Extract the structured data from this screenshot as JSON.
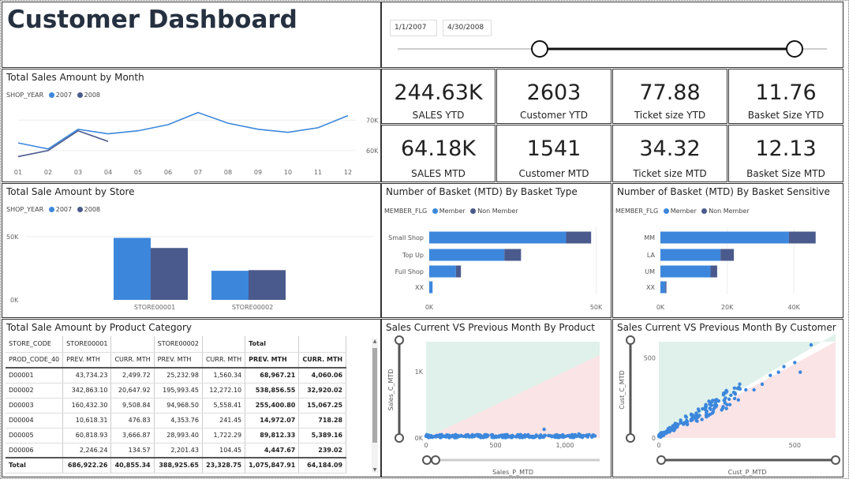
{
  "title": "Customer Dashboard",
  "date_range": {
    "start": "1/1/2007",
    "end": "4/30/2008"
  },
  "kpis": {
    "sales_ytd": {
      "value": "244.63K",
      "label": "SALES YTD"
    },
    "customer_ytd": {
      "value": "2603",
      "label": "Customer YTD"
    },
    "ticket_ytd": {
      "value": "77.88",
      "label": "Ticket size YTD"
    },
    "basket_ytd": {
      "value": "11.76",
      "label": "Basket Size YTD"
    },
    "sales_mtd": {
      "value": "64.18K",
      "label": "SALES MTD"
    },
    "customer_mtd": {
      "value": "1541",
      "label": "Customer MTD"
    },
    "ticket_mtd": {
      "value": "34.32",
      "label": "Ticket size MTD"
    },
    "basket_mtd": {
      "value": "12.13",
      "label": "Basket Size MTD"
    }
  },
  "colors": {
    "c2007": "#3c87dc",
    "c2008": "#4a5a8c",
    "green_zone": "#dff1ea",
    "red_zone": "#fbe4e6"
  },
  "chart_data": [
    {
      "type": "line",
      "title": "Total Sales Amount by Month",
      "legend_title": "SHOP_YEAR",
      "x": [
        "01",
        "02",
        "03",
        "04",
        "05",
        "06",
        "07",
        "08",
        "09",
        "10",
        "11",
        "12"
      ],
      "series": [
        {
          "name": "2007",
          "values": [
            62500,
            60500,
            67000,
            65500,
            66500,
            68500,
            72500,
            69000,
            67000,
            66000,
            67500,
            71500
          ]
        },
        {
          "name": "2008",
          "values": [
            58000,
            60000,
            66500,
            63000
          ]
        }
      ],
      "y_ticks": [
        "60K",
        "70K"
      ],
      "ylim": [
        55000,
        75000
      ]
    },
    {
      "type": "bar",
      "title": "Total Sale Amount by Store",
      "legend_title": "SHOP_YEAR",
      "categories": [
        "STORE00001",
        "STORE00002"
      ],
      "series": [
        {
          "name": "2007",
          "values": [
            49000,
            23000
          ]
        },
        {
          "name": "2008",
          "values": [
            41000,
            23500
          ]
        }
      ],
      "y_ticks": [
        "0K",
        "50K"
      ],
      "ylim": [
        0,
        58000
      ]
    },
    {
      "type": "bar",
      "title": "Number of Basket (MTD) By Basket Type",
      "legend_title": "MEMBER_FLG",
      "categories": [
        "Small Shop",
        "Top Up",
        "Full Shop",
        "XX"
      ],
      "series": [
        {
          "name": "Member",
          "values": [
            41000,
            22500,
            8000,
            1000
          ]
        },
        {
          "name": "Non Member",
          "values": [
            7500,
            5000,
            1500,
            0
          ]
        }
      ],
      "x_ticks": [
        "0K",
        "50K"
      ],
      "xlim": [
        0,
        52000
      ]
    },
    {
      "type": "bar",
      "title": "Number of Basket (MTD) By Basket Sensitive",
      "legend_title": "MEMBER_FLG",
      "categories": [
        "MM",
        "LA",
        "UM",
        "XX"
      ],
      "series": [
        {
          "name": "Member",
          "values": [
            38500,
            18000,
            15000,
            1500
          ]
        },
        {
          "name": "Non Member",
          "values": [
            8000,
            4000,
            2000,
            300
          ]
        }
      ],
      "x_ticks": [
        "0K",
        "20K",
        "40K"
      ],
      "xlim": [
        0,
        52000
      ]
    },
    {
      "type": "scatter",
      "title": "Sales Current VS Previous Month By Product",
      "xlabel": "Sales_P_MTD",
      "ylabel": "Sales_C_MTD",
      "x_ticks": [
        "0",
        "500",
        "1,000"
      ],
      "y_ticks": [
        "0K",
        "1K"
      ],
      "xlim": [
        0,
        1250
      ],
      "ylim": [
        0,
        1450
      ]
    },
    {
      "type": "scatter",
      "title": "Sales Current VS Previous Month By Customer",
      "xlabel": "Cust_P_MTD",
      "ylabel": "Cust_C_MTD",
      "x_ticks": [
        "0",
        "500"
      ],
      "y_ticks": [
        "0",
        "500"
      ],
      "xlim": [
        0,
        650
      ],
      "ylim": [
        0,
        600
      ]
    }
  ],
  "matrix": {
    "title": "Total Sale Amount by Product Category",
    "header1": [
      "STORE_CODE",
      "STORE00001",
      "",
      "STORE00002",
      "",
      "Total",
      ""
    ],
    "header2": [
      "PROD_CODE_40",
      "PREV. MTH",
      "CURR. MTH",
      "PREV. MTH",
      "CURR. MTH",
      "PREV. MTH",
      "CURR. MTH"
    ],
    "rows": [
      [
        "D00001",
        "43,734.23",
        "2,499.72",
        "25,232.98",
        "1,560.34",
        "68,967.21",
        "4,060.06"
      ],
      [
        "D00002",
        "342,863.10",
        "20,647.92",
        "195,993.45",
        "12,272.10",
        "538,856.55",
        "32,920.02"
      ],
      [
        "D00003",
        "160,432.30",
        "9,508.84",
        "94,968.50",
        "5,558.41",
        "255,400.80",
        "15,067.25"
      ],
      [
        "D00004",
        "10,618.31",
        "476.83",
        "4,353.76",
        "241.45",
        "14,972.07",
        "718.28"
      ],
      [
        "D00005",
        "60,818.93",
        "3,666.87",
        "28,993.40",
        "1,722.29",
        "89,812.33",
        "5,389.16"
      ],
      [
        "D00006",
        "2,246.24",
        "134.57",
        "2,201.43",
        "104.45",
        "4,447.67",
        "239.02"
      ]
    ],
    "total": [
      "Total",
      "686,922.26",
      "40,855.34",
      "388,925.65",
      "23,328.75",
      "1,075,847.91",
      "64,184.09"
    ]
  }
}
